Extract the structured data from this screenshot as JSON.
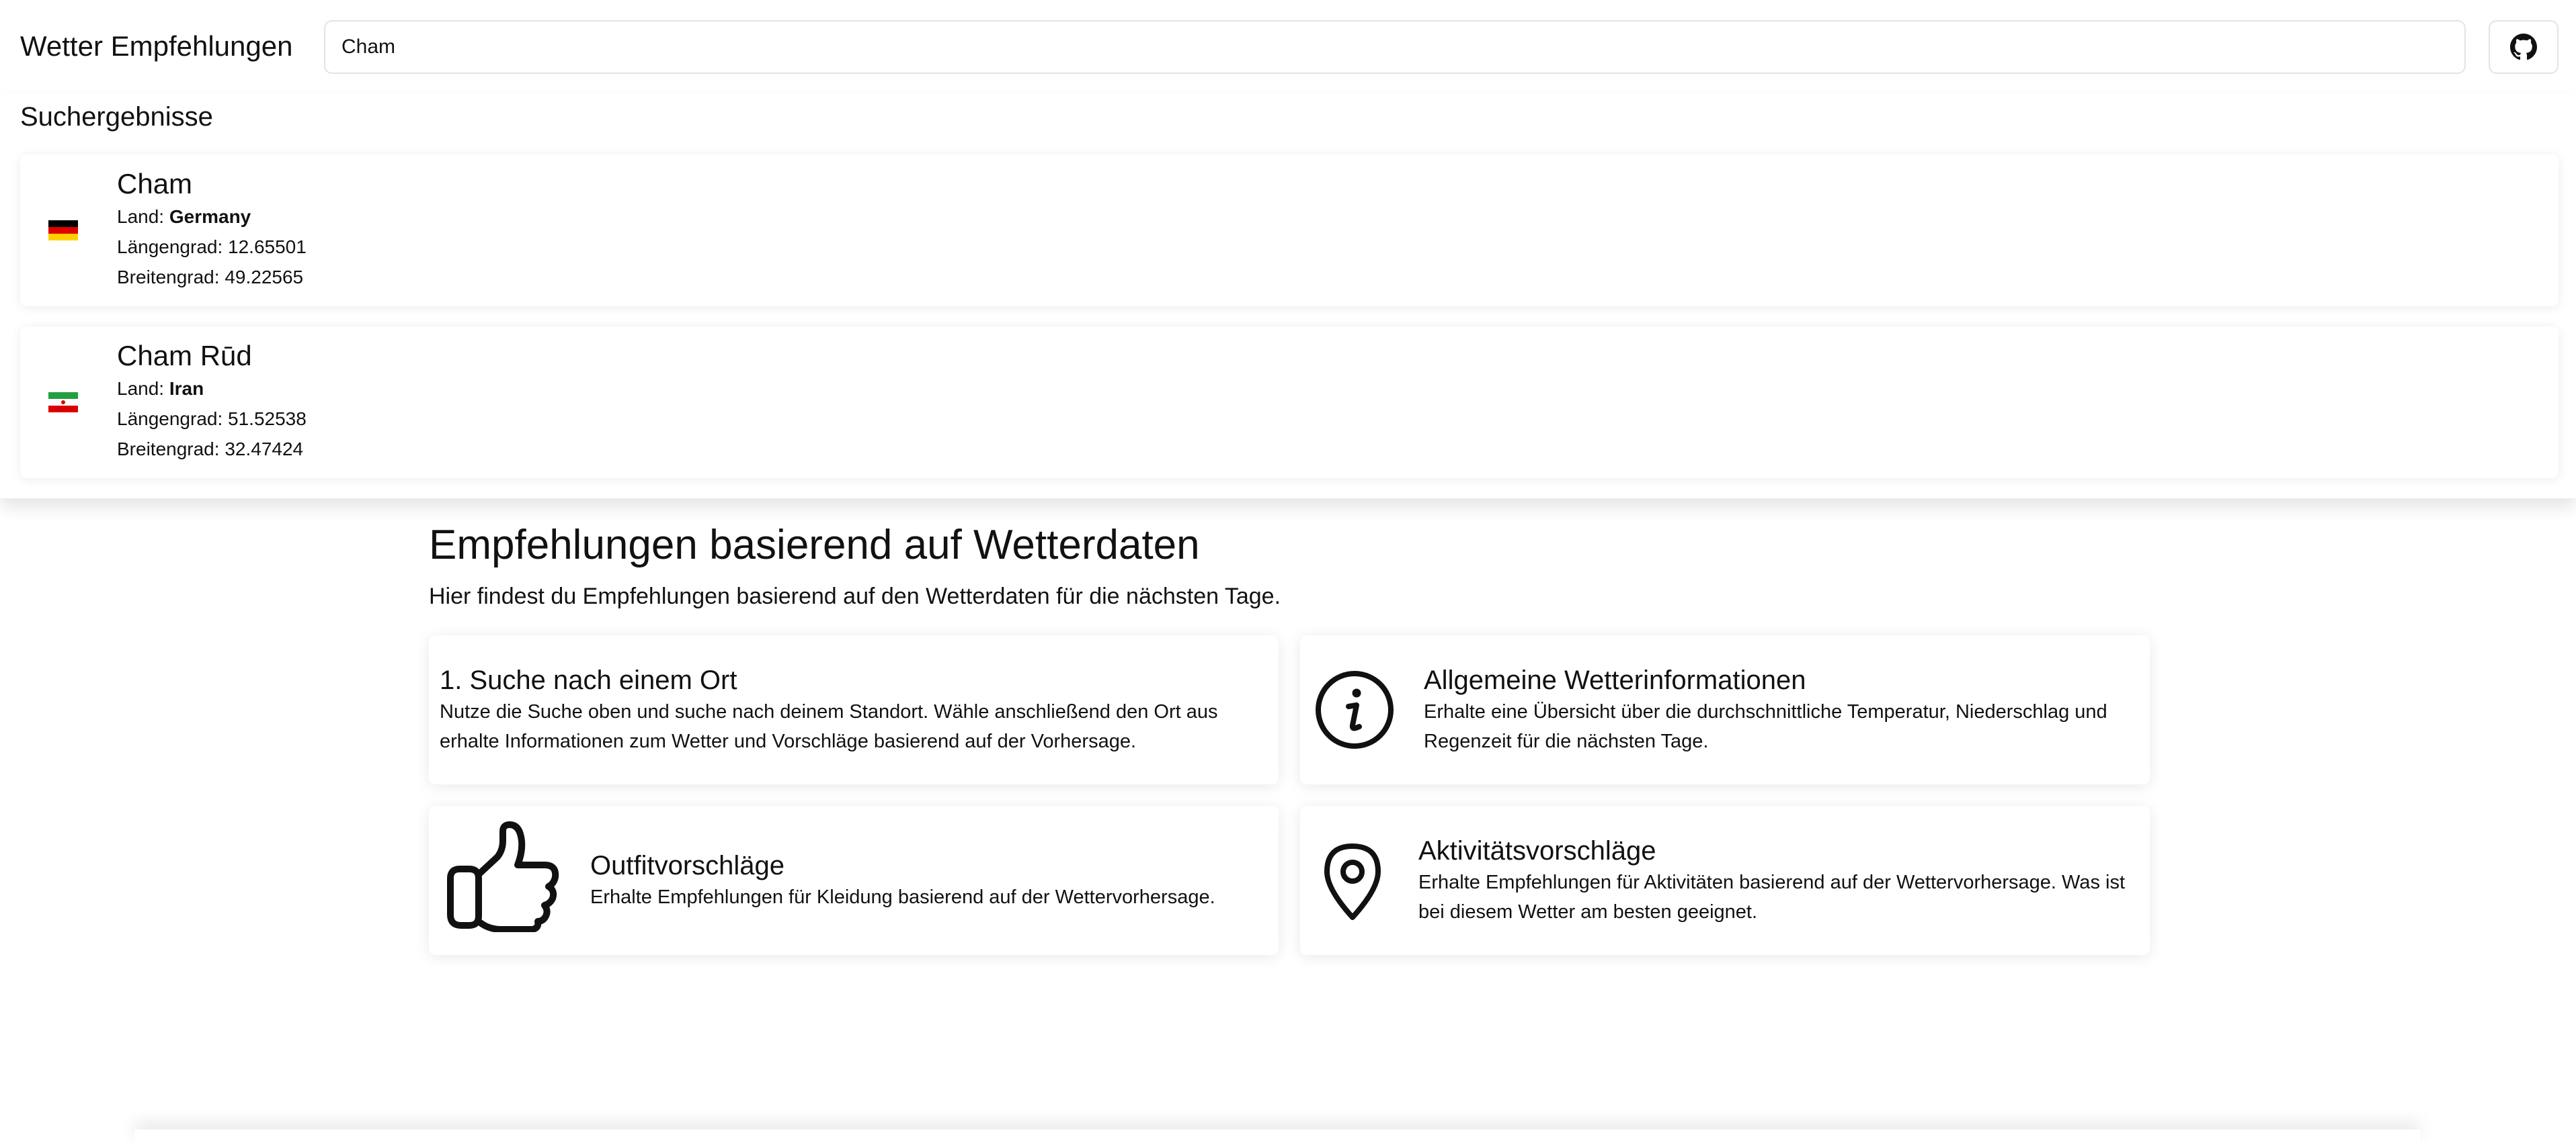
{
  "header": {
    "title": "Wetter Empfehlungen",
    "search_value": "Cham",
    "github_icon": "github-icon"
  },
  "results": {
    "heading": "Suchergebnisse",
    "items": [
      {
        "name": "Cham",
        "country_label": "Land:",
        "country": "Germany",
        "longitude_text": "Längengrad: 12.65501",
        "latitude_text": "Breitengrad: 49.22565",
        "flag_icon": "germany-flag-icon",
        "flag_colors": [
          "#000000",
          "#DD0000",
          "#FFCE00"
        ]
      },
      {
        "name": "Cham Rūd",
        "country_label": "Land:",
        "country": "Iran",
        "longitude_text": "Längengrad: 51.52538",
        "latitude_text": "Breitengrad: 32.47424",
        "flag_icon": "iran-flag-icon",
        "flag_colors": [
          "#239F40",
          "#FFFFFF",
          "#DA0000"
        ]
      }
    ]
  },
  "main": {
    "title": "Empfehlungen basierend auf Wetterdaten",
    "subtitle": "Hier findest du Empfehlungen basierend auf den Wetterdaten für die nächsten Tage.",
    "cards": {
      "search": {
        "title": "1. Suche nach einem Ort",
        "text": "Nutze die Suche oben und suche nach deinem Standort. Wähle anschließend den Ort aus erhalte Informationen zum Wetter und Vorschläge basierend auf der Vorhersage."
      },
      "weather": {
        "title": "Allgemeine Wetterinformationen",
        "text": "Erhalte eine Übersicht über die durchschnittliche Temperatur, Niederschlag und Regenzeit für die nächsten Tage.",
        "icon": "info-icon"
      },
      "outfit": {
        "title": "Outfitvorschläge",
        "text": "Erhalte Empfehlungen für Kleidung basierend auf der Wettervorhersage.",
        "icon": "thumbs-up-icon"
      },
      "activity": {
        "title": "Aktivitätsvorschläge",
        "text": "Erhalte Empfehlungen für Aktivitäten basierend auf der Wettervorhersage. Was ist bei diesem Wetter am besten geeignet.",
        "icon": "map-pin-icon"
      }
    }
  }
}
